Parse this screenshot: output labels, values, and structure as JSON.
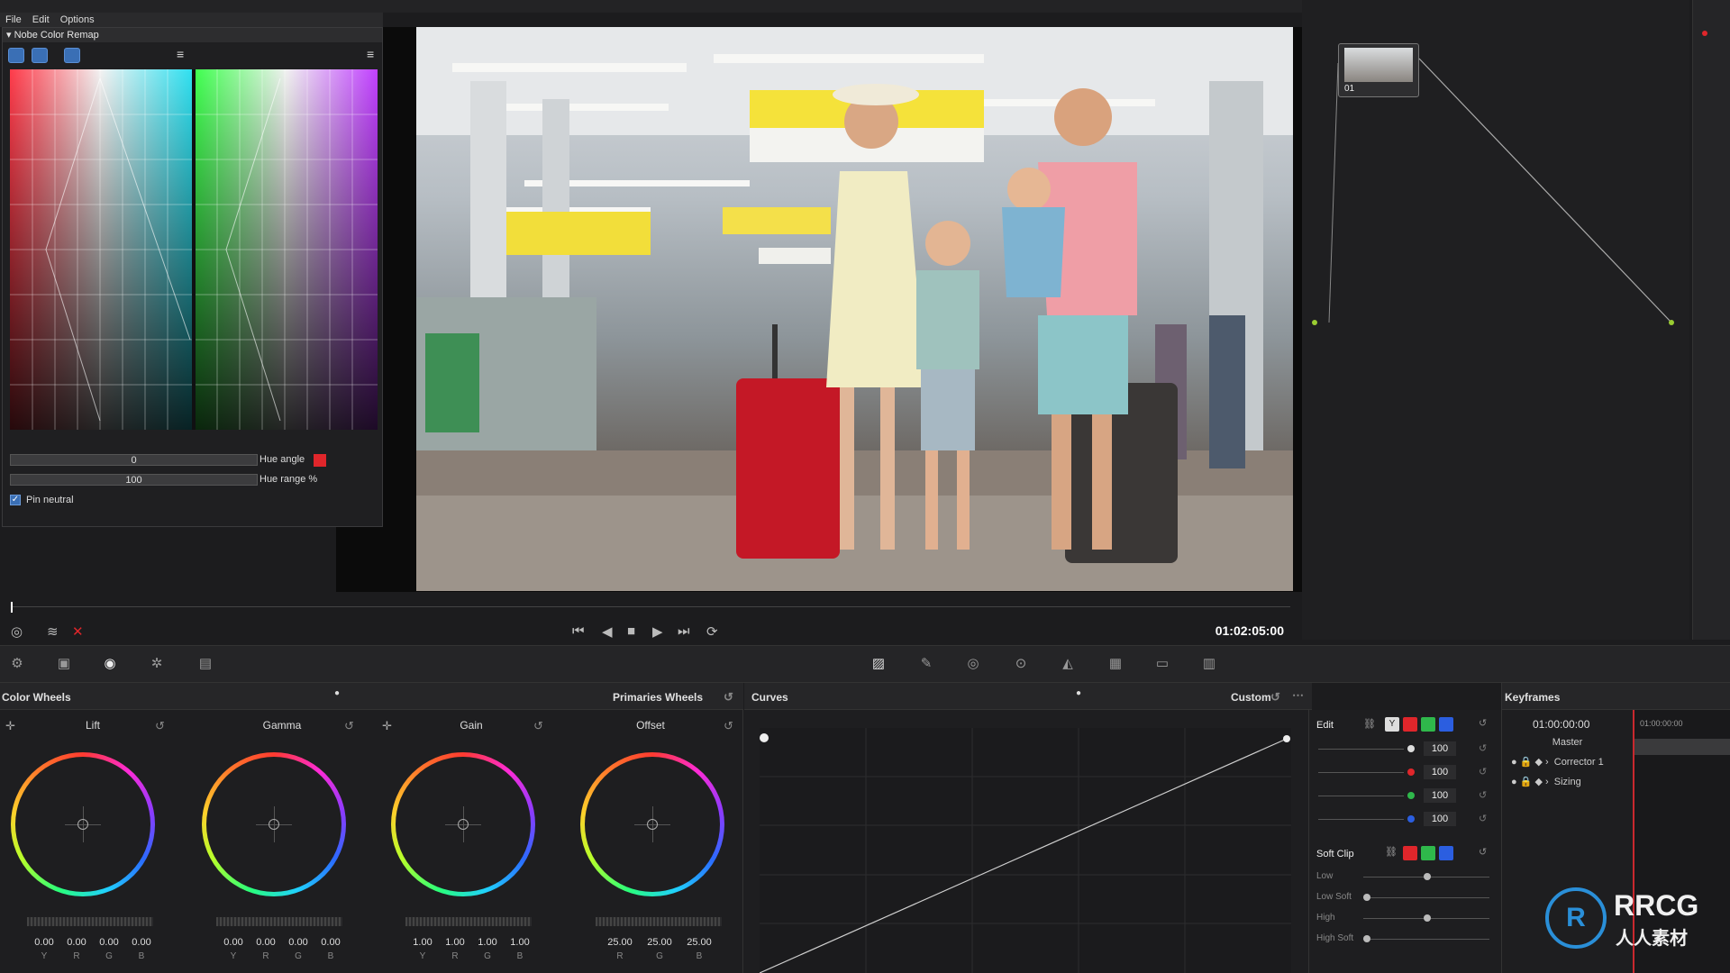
{
  "menu": {
    "file": "File",
    "edit": "Edit",
    "options": "Options"
  },
  "nobe": {
    "title": "Nobe Color Remap",
    "hue_angle_value": "0",
    "hue_angle_label": "Hue angle",
    "hue_range_value": "100",
    "hue_range_label": "Hue range %",
    "pin_neutral_label": "Pin neutral",
    "pin_neutral_checked": true
  },
  "viewer": {
    "timecode": "01:02:05:00"
  },
  "node": {
    "label": "01"
  },
  "color_wheels": {
    "title": "Color Wheels",
    "mode": "Primaries Wheels",
    "wheels": [
      {
        "name": "Lift",
        "values": [
          "0.00",
          "0.00",
          "0.00",
          "0.00"
        ],
        "labels": [
          "Y",
          "R",
          "G",
          "B"
        ]
      },
      {
        "name": "Gamma",
        "values": [
          "0.00",
          "0.00",
          "0.00",
          "0.00"
        ],
        "labels": [
          "Y",
          "R",
          "G",
          "B"
        ]
      },
      {
        "name": "Gain",
        "values": [
          "1.00",
          "1.00",
          "1.00",
          "1.00"
        ],
        "labels": [
          "Y",
          "R",
          "G",
          "B"
        ]
      },
      {
        "name": "Offset",
        "values": [
          "25.00",
          "25.00",
          "25.00"
        ],
        "labels": [
          "R",
          "G",
          "B"
        ]
      }
    ]
  },
  "curves": {
    "title": "Curves",
    "mode": "Custom"
  },
  "edit": {
    "label": "Edit",
    "y_chip": "Y",
    "values": [
      "100",
      "100",
      "100",
      "100"
    ],
    "soft_clip_label": "Soft Clip",
    "soft_clip_rows": [
      "Low",
      "Low Soft",
      "High",
      "High Soft"
    ]
  },
  "keyframes": {
    "title": "Keyframes",
    "timecode": "01:00:00:00",
    "ruler_timecode": "01:00:00:00",
    "rows": [
      "Master",
      "Corrector 1",
      "Sizing"
    ]
  },
  "colors": {
    "accent": "#3a6fb5",
    "red": "#e0262b",
    "green": "#2fb84b",
    "blue": "#2b5ee0"
  },
  "watermark": {
    "brand": "RRCG",
    "subtitle": "人人素材"
  }
}
